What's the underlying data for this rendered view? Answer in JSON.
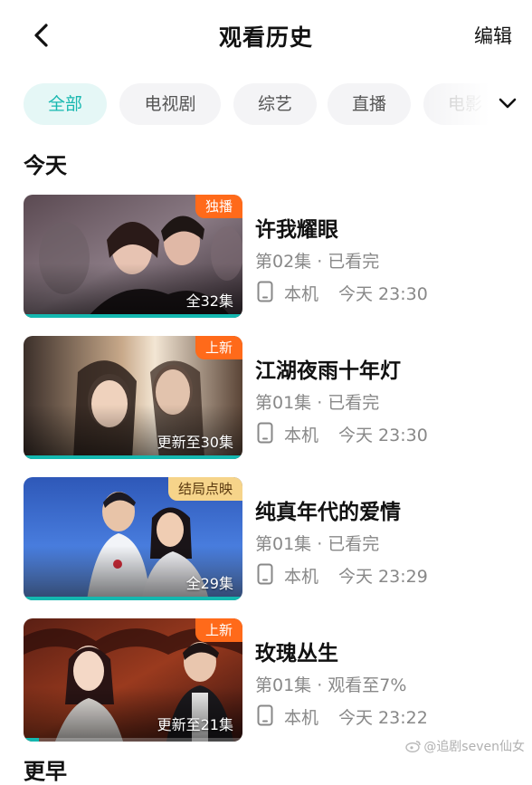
{
  "header": {
    "title": "观看历史",
    "edit_label": "编辑"
  },
  "tabs": [
    {
      "label": "全部",
      "active": true
    },
    {
      "label": "电视剧",
      "active": false
    },
    {
      "label": "综艺",
      "active": false
    },
    {
      "label": "直播",
      "active": false
    },
    {
      "label": "电影",
      "active": false
    }
  ],
  "section": {
    "today": "今天",
    "next": "更早"
  },
  "items": [
    {
      "title": "许我耀眼",
      "status": "第02集 · 已看完",
      "device": "本机",
      "time": "今天 23:30",
      "badge": "独播",
      "badge_color": "#ff6a1a",
      "episodes": "全32集",
      "progress": 1.0
    },
    {
      "title": "江湖夜雨十年灯",
      "status": "第01集 · 已看完",
      "device": "本机",
      "time": "今天 23:30",
      "badge": "上新",
      "badge_color": "#ff6a1a",
      "episodes": "更新至30集",
      "progress": 1.0
    },
    {
      "title": "纯真年代的爱情",
      "status": "第01集 · 已看完",
      "device": "本机",
      "time": "今天 23:29",
      "badge": "结局点映",
      "badge_color": "#f6d48a",
      "episodes": "全29集",
      "progress": 1.0
    },
    {
      "title": "玫瑰丛生",
      "status": "第01集 · 观看至7%",
      "device": "本机",
      "time": "今天 23:22",
      "badge": "上新",
      "badge_color": "#ff6a1a",
      "episodes": "更新至21集",
      "progress": 0.07
    }
  ],
  "watermark": "@追剧seven仙女",
  "icons": {
    "back": "chevron-left-icon",
    "more": "chevron-down-icon",
    "device": "phone-icon"
  },
  "accent_color": "#18b8b0"
}
